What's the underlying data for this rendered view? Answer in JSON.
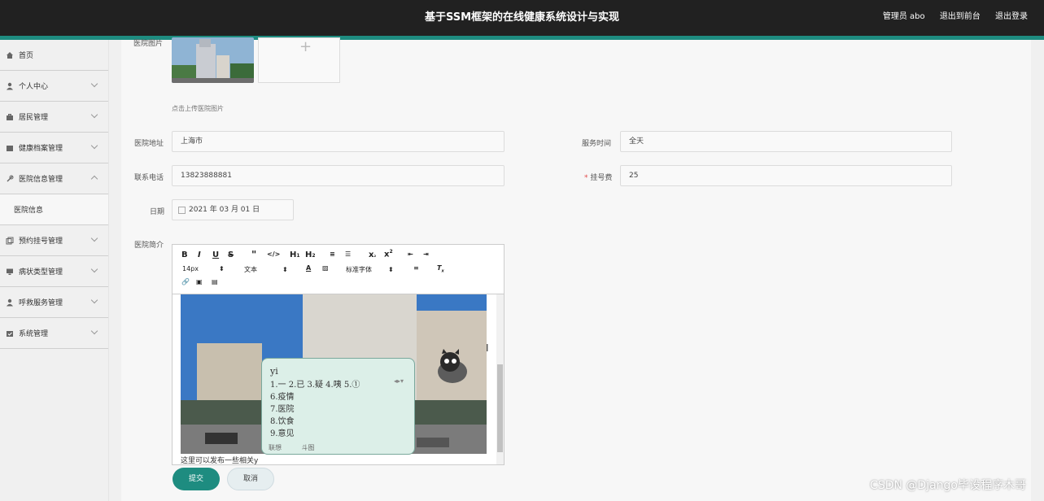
{
  "header": {
    "title": "基于SSM框架的在线健康系统设计与实现",
    "user": "管理员 abo",
    "front_link": "退出到前台",
    "logout_link": "退出登录"
  },
  "sidebar": {
    "items": [
      {
        "label": "首页",
        "icon": "home-icon"
      },
      {
        "label": "个人中心",
        "icon": "user-icon"
      },
      {
        "label": "居民管理",
        "icon": "briefcase-icon"
      },
      {
        "label": "健康档案管理",
        "icon": "folder-icon"
      },
      {
        "label": "医院信息管理",
        "icon": "pin-icon"
      },
      {
        "label": "医院信息",
        "icon": ""
      },
      {
        "label": "预约挂号管理",
        "icon": "copy-icon"
      },
      {
        "label": "病状类型管理",
        "icon": "monitor-icon"
      },
      {
        "label": "呼救服务管理",
        "icon": "user-icon"
      },
      {
        "label": "系统管理",
        "icon": "calendar-icon"
      }
    ]
  },
  "form": {
    "image_label": "医院图片",
    "upload_hint": "点击上传医院图片",
    "address_label": "医院地址",
    "address_value": "上海市",
    "service_label": "服务时间",
    "service_value": "全天",
    "phone_label": "联系电话",
    "phone_value": "13823888881",
    "fee_label": "挂号费",
    "fee_value": "25",
    "date_label": "日期",
    "date_value": "2021 年 03 月 01 日",
    "intro_label": "医院简介",
    "editor_text": "这里可以发布一些相关y",
    "font_size": "14px",
    "text_format": "文本",
    "font_family": "标准字体",
    "submit_label": "提交",
    "cancel_label": "取消"
  },
  "ime": {
    "pinyin": "yi",
    "row1": "1.一 2.已 3.疑 4.咦 5.①",
    "c6": "6.疫情",
    "c7": "7.医院",
    "c8": "8.饮食",
    "c9": "9.意见",
    "tab1": "联想",
    "tab2": "斗图"
  },
  "watermark": "CSDN @Django毕设程序木哥",
  "colors": {
    "accent": "#1e8c80",
    "topbar": "#212121"
  }
}
